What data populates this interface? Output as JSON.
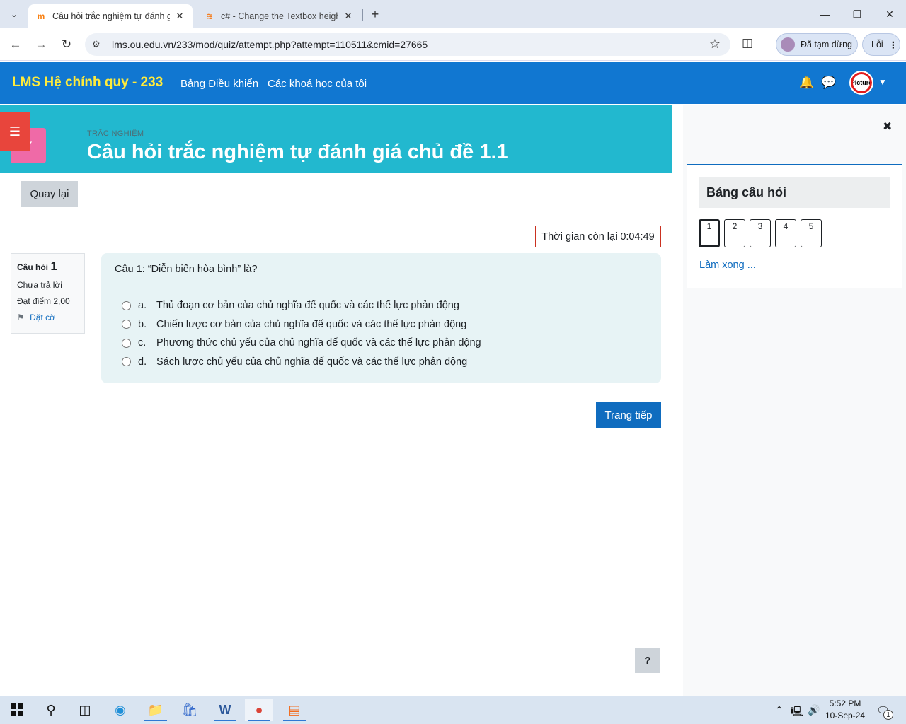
{
  "browser": {
    "tabs": [
      {
        "title": "Câu hỏi trắc nghiệm tự đánh gi",
        "active": true
      },
      {
        "title": "c# - Change the Textbox height",
        "active": false
      }
    ],
    "url": "lms.ou.edu.vn/233/mod/quiz/attempt.php?attempt=110511&cmid=27665",
    "profile_label": "Đã tạm dừng",
    "error_label": "Lỗi"
  },
  "navbar": {
    "brand": "LMS Hệ chính quy - 233",
    "links": [
      "Bảng Điều khiển",
      "Các khoá học của tôi"
    ],
    "avatar_text": "Picture"
  },
  "header": {
    "kicker": "TRẮC NGHIỆM",
    "title": "Câu hỏi trắc nghiệm tự đánh giá chủ đề 1.1"
  },
  "back_label": "Quay lại",
  "timer": "Thời gian còn lại 0:04:49",
  "question_info": {
    "label": "Câu hỏi",
    "number": "1",
    "status": "Chưa trả lời",
    "mark": "Đạt điểm 2,00",
    "flag": "Đặt cờ"
  },
  "question": {
    "text": "Câu 1: “Diễn biến hòa bình” là?",
    "answers": [
      {
        "letter": "a.",
        "text": "Thủ đoạn cơ bản của chủ nghĩa đế quốc và các thế lực phản động"
      },
      {
        "letter": "b.",
        "text": "Chiến lược cơ bản của chủ nghĩa đế quốc và các thế lực phản động"
      },
      {
        "letter": "c.",
        "text": "Phương thức chủ yếu của chủ nghĩa đế quốc và các thế lực phản động"
      },
      {
        "letter": "d.",
        "text": "Sách lược chủ yếu của chủ nghĩa đế quốc và các thế lực phản động"
      }
    ]
  },
  "next_label": "Trang tiếp",
  "help_label": "?",
  "drawer": {
    "title": "Bảng câu hỏi",
    "questions": [
      "1",
      "2",
      "3",
      "4",
      "5"
    ],
    "finish_label": "Làm xong ..."
  },
  "taskbar": {
    "time": "5:52 PM",
    "date": "10-Sep-24",
    "notification_count": "1"
  }
}
